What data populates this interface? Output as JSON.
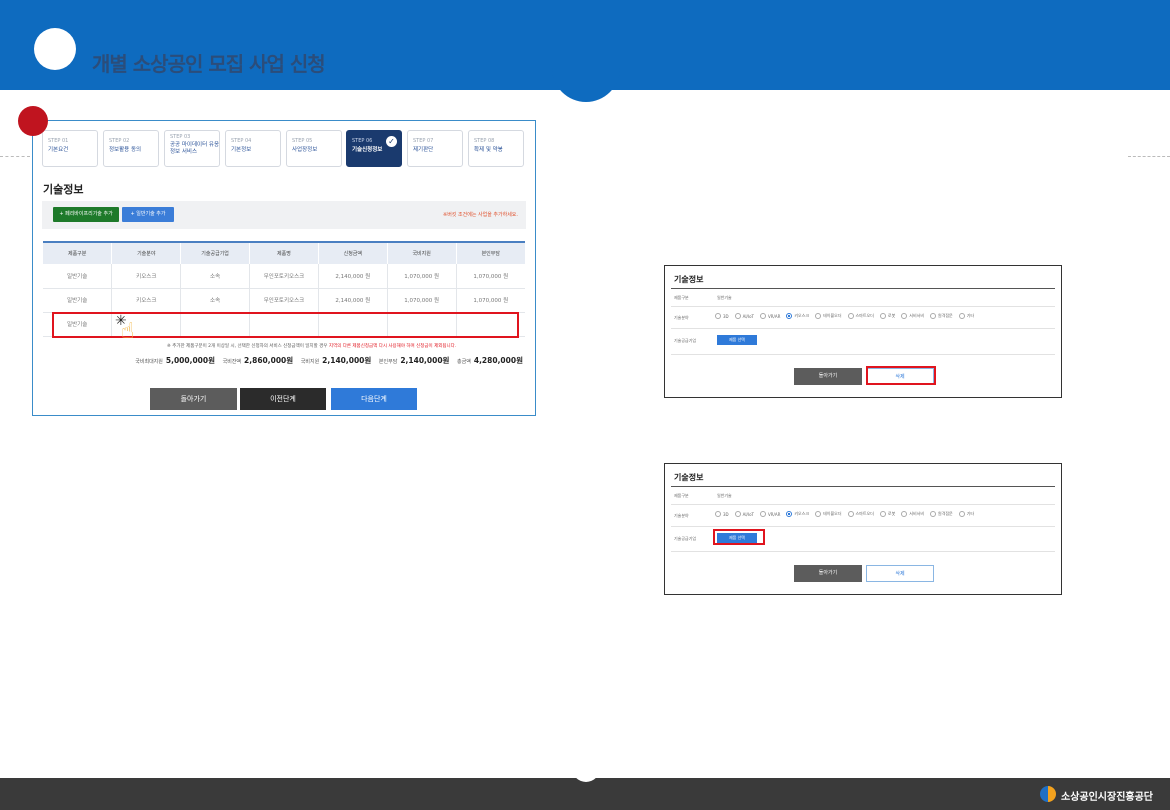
{
  "header": {
    "title": "개별 소상공인 모집 사업 신청"
  },
  "steps": [
    {
      "num": "STEP 01",
      "label": "기본요건"
    },
    {
      "num": "STEP 02",
      "label": "정보활용 동의"
    },
    {
      "num": "STEP 03",
      "label": "공공 마이데이터 유응정보 서비스"
    },
    {
      "num": "STEP 04",
      "label": "기본정보"
    },
    {
      "num": "STEP 05",
      "label": "사업장정보"
    },
    {
      "num": "STEP 06",
      "label": "기술신청정보"
    },
    {
      "num": "STEP 07",
      "label": "제기판단"
    },
    {
      "num": "STEP 08",
      "label": "확제 및 약봉"
    }
  ],
  "left": {
    "section_title": "기술정보",
    "add_smart_label": "+ 페리바이프리기술 추가",
    "add_general_label": "+ 일반기술 추가",
    "toolbar_note": "※버킷 조건에는 사업을 추가하세요.",
    "table": {
      "headers": [
        "제품구분",
        "기술분야",
        "기술공급기업",
        "제품명",
        "신청금액",
        "국비지원",
        "본인부담"
      ],
      "rows": [
        [
          "일반기술",
          "키오스크",
          "소속",
          "무인포토키오스크",
          "2,140,000 원",
          "1,070,000 원",
          "1,070,000 원"
        ],
        [
          "일반기술",
          "키오스크",
          "소속",
          "무인포토키오스크",
          "2,140,000 원",
          "1,070,000 원",
          "1,070,000 원"
        ],
        [
          "일반기술",
          "",
          "",
          "",
          "",
          "",
          ""
        ]
      ]
    },
    "notice": "※ 추가한 제품구분이 2개 이상일 시, 선택한 신청자의 서비스 신청금액이 일치할 경우",
    "notice_red": "지역의 다른 제품신청금액 다시 사용해야 하며 신청금이 제외됩니다.",
    "summary": [
      {
        "label": "국비최대지원",
        "value": "5,000,000원"
      },
      {
        "label": "국비잔액",
        "value": "2,860,000원"
      },
      {
        "label": "국비지원",
        "value": "2,140,000원"
      },
      {
        "label": "본인부담",
        "value": "2,140,000원"
      },
      {
        "label": "총금액",
        "value": "4,280,000원"
      }
    ],
    "btn_back": "돌아가기",
    "btn_prev": "이전단계",
    "btn_next": "다음단계"
  },
  "mini1": {
    "title": "기술정보",
    "type_label": "제품구분",
    "type_value": "일반기술",
    "field_label": "기술분야",
    "options": [
      "3D",
      "AI/IoT",
      "VR/AR",
      "키오스크",
      "테이블오더",
      "스마트오더",
      "로봇",
      "서비서비",
      "원격점문",
      "기타"
    ],
    "selected": "키오스크",
    "supplier_label": "기술공급기업",
    "pick_label": "제품 선택",
    "back_label": "돌아가기",
    "delete_label": "삭제"
  },
  "mini2": {
    "title": "기술정보",
    "type_label": "제품구분",
    "type_value": "일반기술",
    "field_label": "기술분야",
    "options": [
      "3D",
      "AI/IoT",
      "VR/AR",
      "키오스크",
      "테이블오더",
      "스마트오더",
      "로봇",
      "서비서비",
      "원격점문",
      "기타"
    ],
    "selected": "키오스크",
    "supplier_label": "기술공급기업",
    "pick_label": "제품 선택",
    "back_label": "돌아가기",
    "delete_label": "삭제"
  },
  "footer": {
    "org": "소상공인시장진흥공단"
  }
}
